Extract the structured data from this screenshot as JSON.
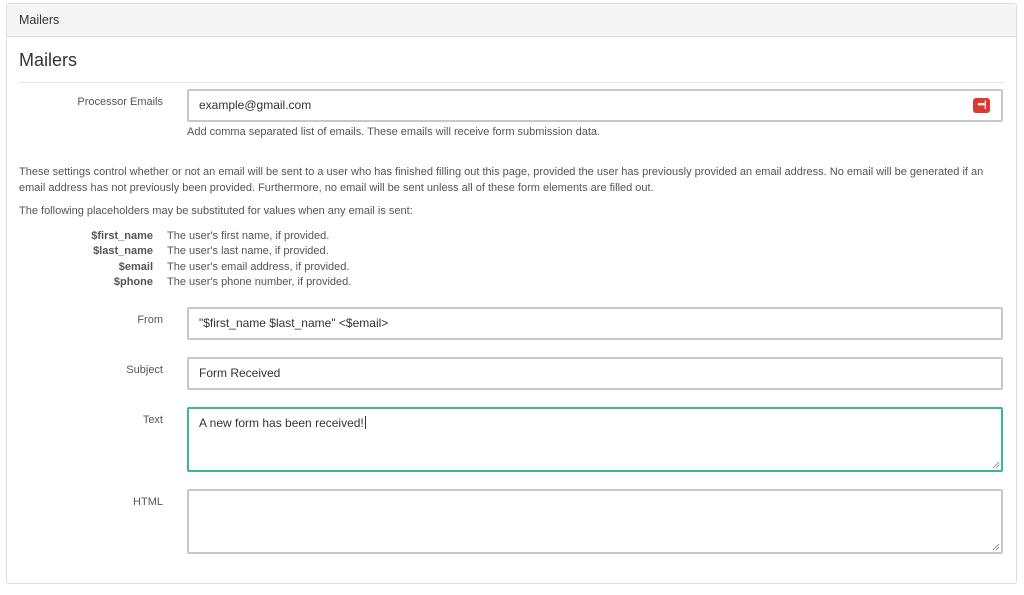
{
  "panel": {
    "heading": "Mailers"
  },
  "section": {
    "title": "Mailers"
  },
  "processor_emails": {
    "label": "Processor Emails",
    "value": "example@gmail.com",
    "help": "Add comma separated list of emails. These emails will receive form submission data.",
    "password_manager_icon": "lastpass-icon",
    "icon_glyph": "•••|",
    "icon_color": "#d93a32"
  },
  "description": {
    "paragraph1": "These settings control whether or not an email will be sent to a user who has finished filling out this page, provided the user has previously provided an email address. No email will be generated if an email address has not previously been provided. Furthermore, no email will be sent unless all of these form elements are filled out.",
    "paragraph2": "The following placeholders may be substituted for values when any email is sent:"
  },
  "placeholders": [
    {
      "key": "$first_name",
      "desc": "The user's first name, if provided."
    },
    {
      "key": "$last_name",
      "desc": "The user's last name, if provided."
    },
    {
      "key": "$email",
      "desc": "The user's email address, if provided."
    },
    {
      "key": "$phone",
      "desc": "The user's phone number, if provided."
    }
  ],
  "from": {
    "label": "From",
    "value": "\"$first_name $last_name\" <$email>"
  },
  "subject": {
    "label": "Subject",
    "value": "Form Received"
  },
  "text": {
    "label": "Text",
    "value": "A new form has been received!"
  },
  "html": {
    "label": "HTML",
    "value": ""
  },
  "colors": {
    "focus_border": "#3cb891",
    "panel_heading_bg": "#f5f5f5"
  }
}
